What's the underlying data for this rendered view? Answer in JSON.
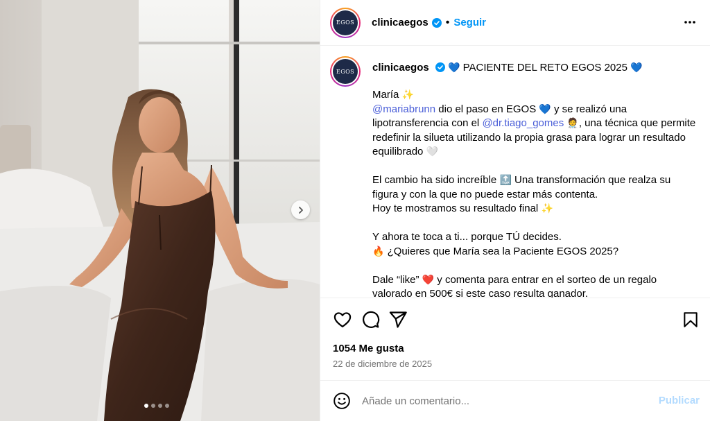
{
  "post": {
    "account": "clinicaegos",
    "avatar_text": "EGOS",
    "follow_label": "Seguir",
    "separator": "•",
    "more_icon": "more-horizontal-icon"
  },
  "caption": {
    "username": "clinicaegos",
    "headline": "PACIENTE DEL RETO EGOS 2025",
    "heart_blue": "💙",
    "sparkles": "✨",
    "line1_name": "María",
    "mention1": "@mariabrunn",
    "line2_a": " dio el paso en EGOS ",
    "line2_b": " y se realizó una lipotransferencia con el ",
    "mention2": "@dr.tiago_gomes",
    "doctor_emoji": "🧑‍⚕️",
    "line2_c": ", una técnica que permite redefinir la silueta utilizando la propia grasa para lograr un resultado equilibrado ",
    "heart_purple": "🤍",
    "para2_a": "El cambio ha sido increíble ",
    "top_emoji": "🔝",
    "para2_b": " Una transformación que realza su figura y con la que no puede estar más contenta.",
    "para2_c": "Hoy te mostramos su resultado final ",
    "para3_a": "Y ahora te toca a ti... porque TÚ decides.",
    "fire": "🔥",
    "para3_b": " ¿Quieres que María sea la Paciente EGOS 2025?",
    "para4_a": "Dale “like” ",
    "heart_red": "❤️",
    "para4_b": " y comenta para entrar en el sorteo de un regalo valorado en 500€ si este caso resulta ganador."
  },
  "stats": {
    "likes": "1054 Me gusta",
    "date": "22 de diciembre de 2025"
  },
  "comment": {
    "placeholder": "Añade un comentario...",
    "publish_label": "Publicar"
  },
  "carousel": {
    "total": 4,
    "current": 1
  },
  "colors": {
    "link": "#0095f6",
    "mention": "#4a5ed8",
    "publish_disabled": "#b3dbff",
    "muted": "#737373"
  }
}
